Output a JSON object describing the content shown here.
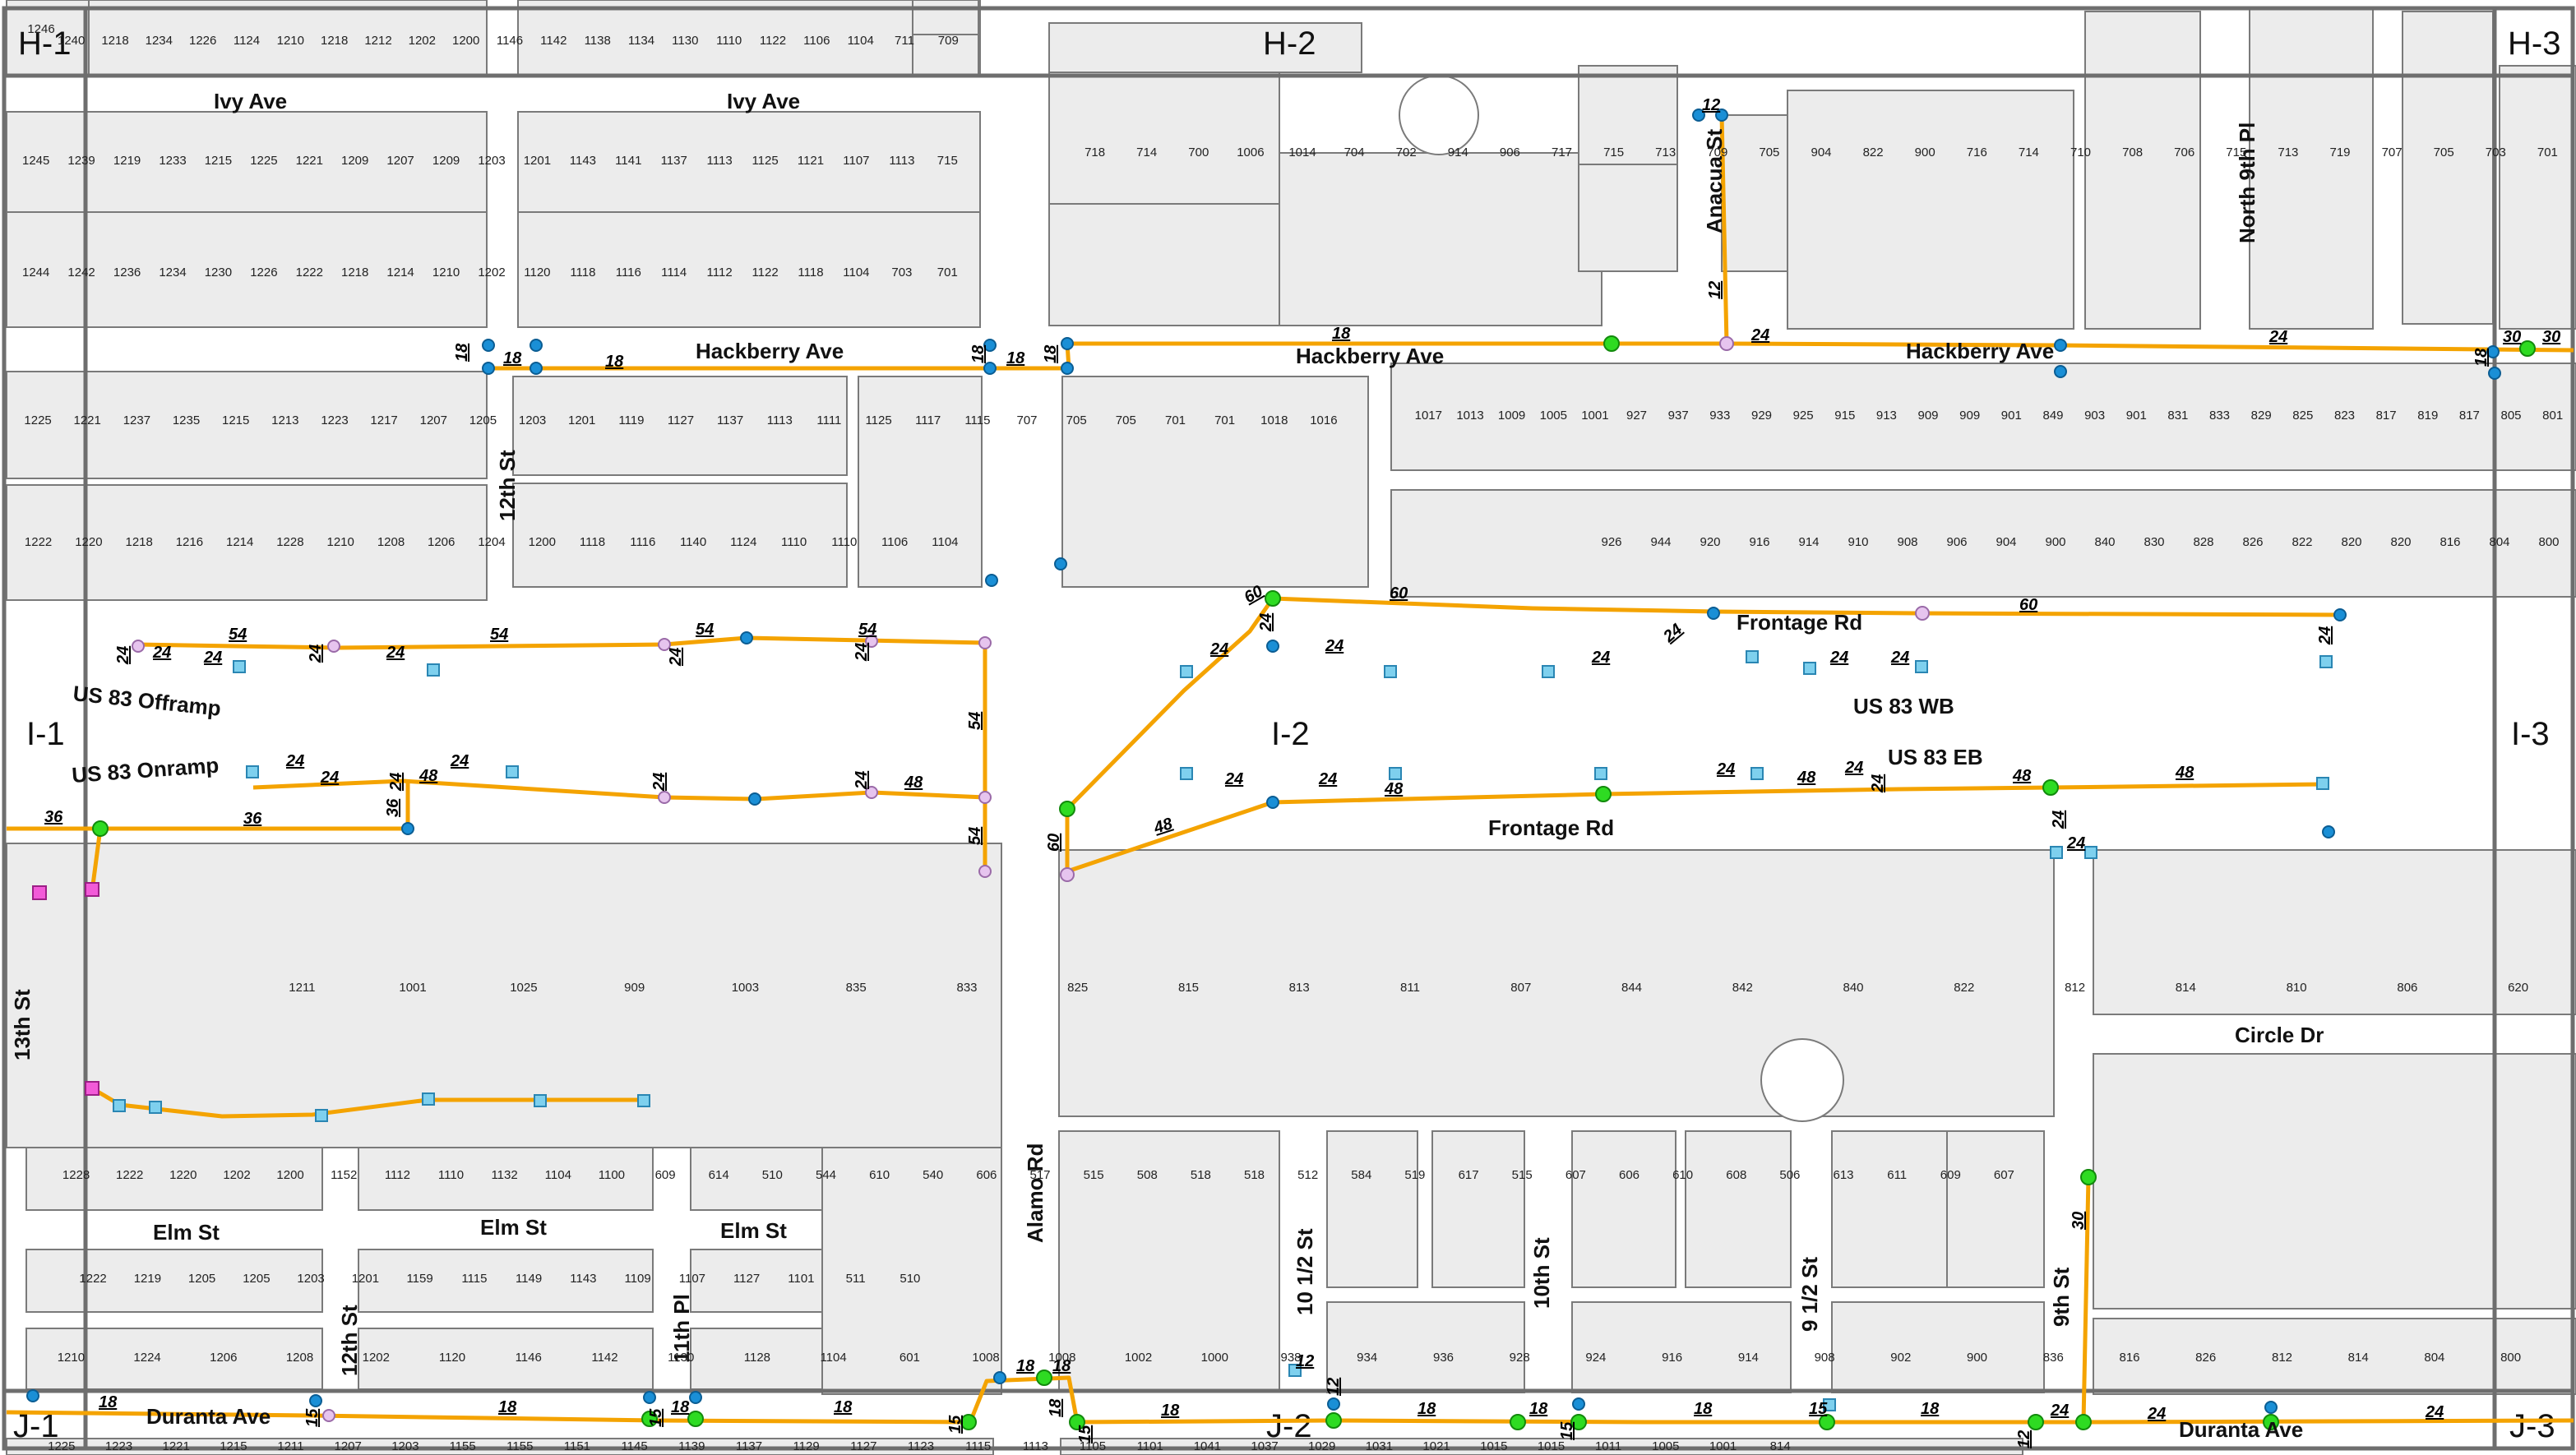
{
  "map": {
    "grid_labels": [
      "H-1",
      "H-2",
      "H-3",
      "I-1",
      "I-2",
      "I-3",
      "J-1",
      "J-2",
      "J-3"
    ],
    "streets": {
      "ivy_1": "Ivy Ave",
      "ivy_2": "Ivy Ave",
      "hackberry_1": "Hackberry Ave",
      "hackberry_2": "Hackberry Ave",
      "hackberry_3": "Hackberry Ave",
      "anacua": "Anacua St",
      "north9th": "North 9th Pl",
      "twelfth_top": "12th St",
      "frontage_top": "Frontage Rd",
      "us83wb": "US 83 WB",
      "us83eb": "US 83 EB",
      "frontage_bot": "Frontage Rd",
      "offramp": "US 83 Offramp",
      "onramp": "US 83 Onramp",
      "circle": "Circle Dr",
      "thirteenth": "13th St",
      "elm_1": "Elm St",
      "elm_2": "Elm St",
      "elm_3": "Elm St",
      "twelfth_bot": "12th St",
      "eleventh": "11th Pl",
      "alamo": "Alamo Rd",
      "ten_half": "10 1/2 St",
      "tenth": "10th St",
      "nine_half": "9 1/2 St",
      "ninth": "9th St",
      "duranta_1": "Duranta Ave",
      "duranta_2": "Duranta Ave"
    },
    "pipe_sizes": {
      "hb1": "18",
      "hb2": "18",
      "hb3": "18",
      "hb4": "18",
      "hb5": "18",
      "hb6": "18",
      "hb7": "18",
      "hb8": "24",
      "hb9": "24",
      "hb10": "18",
      "hb11": "30",
      "hb12": "30",
      "an1": "12",
      "an2": "12",
      "f60a": "60",
      "f60b": "60",
      "f60c": "60",
      "f60d": "60",
      "f24a": "24",
      "f24b": "24",
      "f24c": "24",
      "f24d": "24",
      "f24e": "24",
      "f24f": "24",
      "f24g": "24",
      "f24h": "24",
      "of54a": "54",
      "of54b": "54",
      "of54c": "54",
      "of54d": "54",
      "of24a": "24",
      "of24b": "24",
      "of24c": "24",
      "of24d": "24",
      "of24e": "24",
      "of24f": "24",
      "of24g": "24",
      "on24a": "24",
      "on24b": "24",
      "on24c": "24",
      "on24d": "24",
      "on24e": "24",
      "on24f": "24",
      "on48a": "48",
      "on48b": "48",
      "on36a": "36",
      "on36b": "36",
      "on36c": "36",
      "v54a": "54",
      "v54b": "54",
      "eb24a": "24",
      "eb24b": "24",
      "eb24c": "24",
      "eb24d": "24",
      "eb48a": "48",
      "eb48b": "48",
      "eb48c": "48",
      "eb48d": "48",
      "eb48e": "48",
      "eb24e": "24",
      "eb24f": "24",
      "eb24g": "24",
      "n9_30": "30",
      "d18a": "18",
      "d18b": "18",
      "d18c": "18",
      "d18d": "18",
      "d18e": "18",
      "d18f": "18",
      "d18g": "18",
      "d18h": "18",
      "d18i": "18",
      "d18j": "18",
      "d15a": "15",
      "d15b": "15",
      "d15c": "15",
      "d15d": "15",
      "d15e": "15",
      "d15f": "15",
      "d12a": "12",
      "d12b": "12",
      "d12c": "12",
      "d24a": "24",
      "d24b": "24",
      "d24c": "24",
      "d18k": "18",
      "d18l": "18"
    },
    "parcels": {
      "r1": [
        "1246",
        "1240",
        "1218",
        "1234",
        "1226",
        "1124",
        "1210",
        "1218",
        "1212",
        "1202",
        "1200",
        "1146",
        "1142",
        "1138",
        "1134",
        "1130",
        "1110",
        "1122",
        "1106",
        "1104",
        "711",
        "709"
      ],
      "r2": [
        "1245",
        "1239",
        "1219",
        "1233",
        "1215",
        "1225",
        "1221",
        "1209",
        "1207",
        "1209",
        "1203",
        "1201",
        "1143",
        "1141",
        "1137",
        "1113",
        "1125",
        "1121",
        "1107",
        "1113",
        "715"
      ],
      "r3": [
        "1244",
        "1242",
        "1236",
        "1234",
        "1230",
        "1226",
        "1222",
        "1218",
        "1214",
        "1210",
        "1202",
        "1120",
        "1118",
        "1116",
        "1114",
        "1112",
        "1122",
        "1118",
        "1104",
        "703",
        "701"
      ],
      "h2": [
        "718",
        "714",
        "700",
        "1006",
        "1014",
        "704",
        "702",
        "914",
        "906",
        "717",
        "715",
        "713",
        "709",
        "705",
        "904",
        "822",
        "900",
        "716",
        "714",
        "710",
        "708",
        "706",
        "715",
        "713",
        "719",
        "707",
        "705",
        "703",
        "701"
      ],
      "r4": [
        "1225",
        "1221",
        "1237",
        "1235",
        "1215",
        "1213",
        "1223",
        "1217",
        "1207",
        "1205",
        "1203",
        "1201",
        "1119",
        "1127",
        "1137",
        "1113",
        "1111",
        "1125",
        "1117",
        "1115",
        "707",
        "705",
        "705",
        "701",
        "701",
        "1018",
        "1016"
      ],
      "r5": [
        "1222",
        "1220",
        "1218",
        "1216",
        "1214",
        "1228",
        "1210",
        "1208",
        "1206",
        "1204",
        "1200",
        "1118",
        "1116",
        "1140",
        "1124",
        "1110",
        "1110",
        "1106",
        "1104"
      ],
      "r6": [
        "1017",
        "1013",
        "1009",
        "1005",
        "1001",
        "927",
        "937",
        "933",
        "929",
        "925",
        "915",
        "913",
        "909",
        "909",
        "901",
        "849",
        "903",
        "901",
        "831",
        "833",
        "829",
        "825",
        "823",
        "817",
        "819",
        "817",
        "805",
        "801"
      ],
      "r7": [
        "926",
        "944",
        "920",
        "916",
        "914",
        "910",
        "908",
        "906",
        "904",
        "900",
        "840",
        "830",
        "828",
        "826",
        "822",
        "820",
        "820",
        "816",
        "804",
        "800"
      ],
      "mid": [
        "1211",
        "1001",
        "1025",
        "909",
        "1003",
        "835",
        "833",
        "825",
        "815",
        "813",
        "811",
        "807",
        "844",
        "842",
        "840",
        "822",
        "812",
        "814",
        "810",
        "806",
        "620"
      ],
      "r8": [
        "1228",
        "1222",
        "1220",
        "1202",
        "1200",
        "1152",
        "1112",
        "1110",
        "1132",
        "1104",
        "1100",
        "609",
        "614",
        "510",
        "544",
        "610",
        "540",
        "606",
        "517",
        "515",
        "508",
        "518",
        "518",
        "512",
        "584",
        "519",
        "617",
        "515",
        "607",
        "606",
        "610",
        "608",
        "506",
        "613",
        "611",
        "609",
        "607"
      ],
      "r9": [
        "1222",
        "1219",
        "1205",
        "1205",
        "1203",
        "1201",
        "1159",
        "1115",
        "1149",
        "1143",
        "1109",
        "1107",
        "1127",
        "1101",
        "511",
        "510"
      ],
      "r10": [
        "1210",
        "1224",
        "1206",
        "1208",
        "1202",
        "1120",
        "1146",
        "1142",
        "1130",
        "1128",
        "1104",
        "601",
        "1008",
        "1008",
        "1002",
        "1000",
        "938",
        "934",
        "936",
        "928",
        "924",
        "916",
        "914",
        "908",
        "902",
        "900",
        "836",
        "816",
        "826",
        "812",
        "814",
        "804",
        "800"
      ],
      "r11": [
        "1225",
        "1223",
        "1221",
        "1215",
        "1211",
        "1207",
        "1203",
        "1155",
        "1155",
        "1151",
        "1145",
        "1139",
        "1137",
        "1129",
        "1127",
        "1123",
        "1115",
        "1113",
        "1105",
        "1101",
        "1041",
        "1037",
        "1029",
        "1031",
        "1021",
        "1015",
        "1015",
        "1011",
        "1005",
        "1001",
        "814"
      ]
    }
  }
}
